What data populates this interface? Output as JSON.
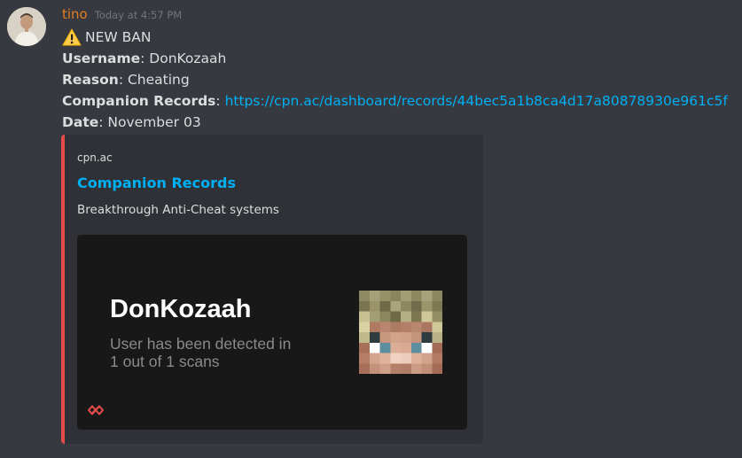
{
  "author": {
    "name": "tino",
    "timestamp": "Today at 4:57 PM",
    "name_color": "#e67e22",
    "avatar_icon": "user-avatar"
  },
  "message": {
    "headline_icon": "warning-icon",
    "headline": "NEW BAN",
    "username_label": "Username",
    "username_sep": ": ",
    "username_value": "DonKozaah",
    "reason_label": "Reason",
    "reason_sep": ": ",
    "reason_value": "Cheating",
    "records_label": "Companion Records",
    "records_sep": ": ",
    "records_url": "https://cpn.ac/dashboard/records/44bec5a1b8ca4d17a80878930e961c5f",
    "date_label": "Date",
    "date_sep": ": ",
    "date_value": "November 03"
  },
  "embed": {
    "accent_color": "#e74c4c",
    "provider": "cpn.ac",
    "title": "Companion Records",
    "description": "Breakthrough Anti-Cheat systems",
    "card": {
      "player_name": "DonKozaah",
      "detection_line1": "User has been detected in",
      "detection_line2": "1 out of 1 scans",
      "skin_icon": "player-skin-head",
      "logo_icon": "companion-logo-icon"
    }
  }
}
